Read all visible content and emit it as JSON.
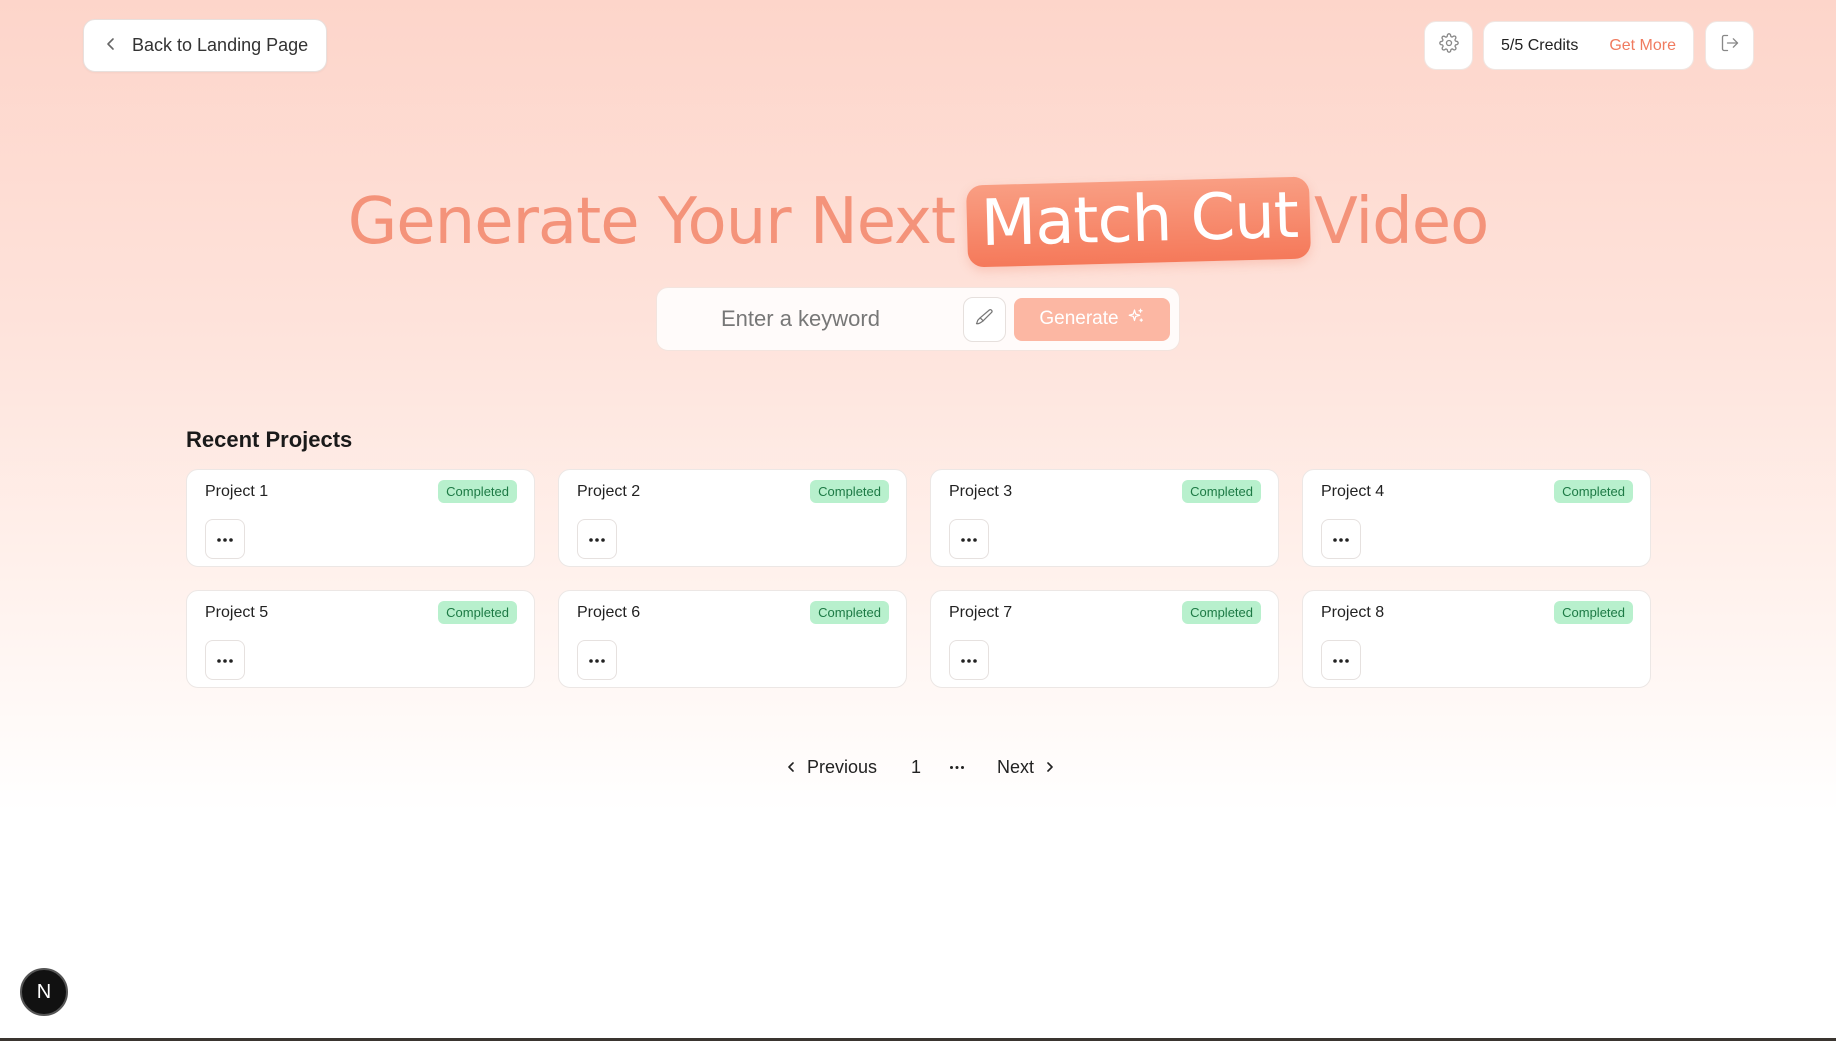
{
  "header": {
    "back_label": "Back to Landing Page",
    "credits_label": "5/5 Credits",
    "get_more_label": "Get More"
  },
  "hero": {
    "prefix": "Generate Your Next",
    "highlight": "Match Cut",
    "suffix": "Video"
  },
  "search": {
    "placeholder": "Enter a keyword",
    "generate_label": "Generate"
  },
  "projects": {
    "title": "Recent Projects",
    "items": [
      {
        "name": "Project 1",
        "status": "Completed"
      },
      {
        "name": "Project 2",
        "status": "Completed"
      },
      {
        "name": "Project 3",
        "status": "Completed"
      },
      {
        "name": "Project 4",
        "status": "Completed"
      },
      {
        "name": "Project 5",
        "status": "Completed"
      },
      {
        "name": "Project 6",
        "status": "Completed"
      },
      {
        "name": "Project 7",
        "status": "Completed"
      },
      {
        "name": "Project 8",
        "status": "Completed"
      }
    ]
  },
  "pagination": {
    "previous_label": "Previous",
    "current_page": "1",
    "next_label": "Next"
  },
  "dev_badge": {
    "label": "N"
  },
  "colors": {
    "accent": "#f4937a",
    "accent_strong": "#f5795a",
    "status_green_bg": "#b8f0cd",
    "status_green_text": "#1d7a45"
  },
  "icons": {
    "back": "chevron-left-icon",
    "settings": "gear-icon",
    "logout": "logout-icon",
    "brush": "brush-icon",
    "sparkle": "sparkle-icon",
    "menu": "more-horizontal-icon"
  }
}
